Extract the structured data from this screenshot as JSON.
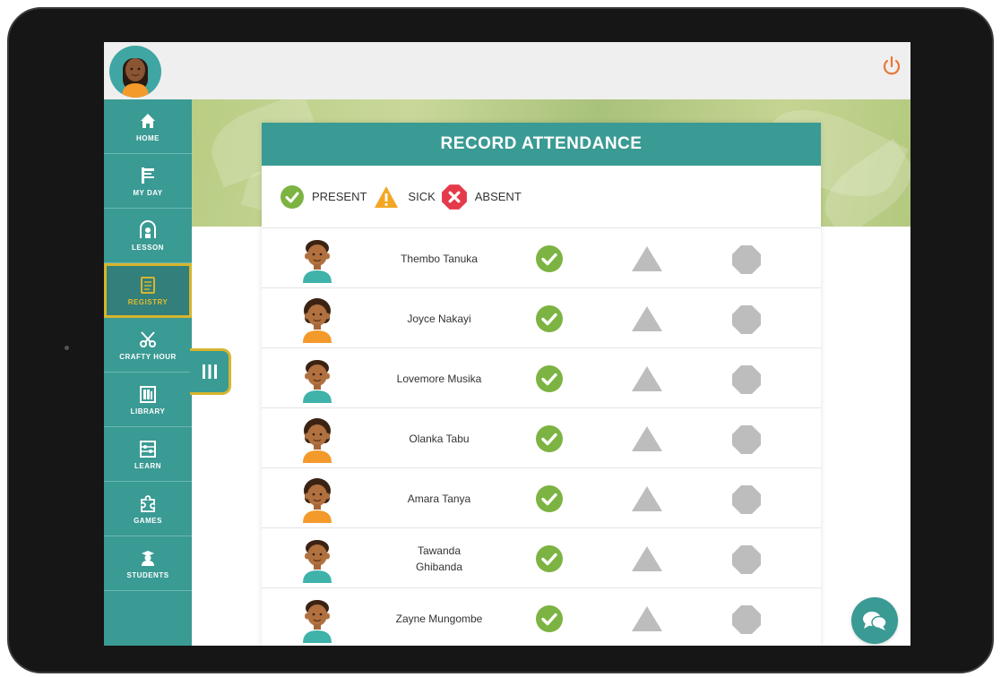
{
  "sidebar": {
    "items": [
      {
        "label": "HOME",
        "icon": "home-icon"
      },
      {
        "label": "MY DAY",
        "icon": "flag-icon"
      },
      {
        "label": "LESSON",
        "icon": "teacher-icon"
      },
      {
        "label": "REGISTRY",
        "icon": "book-icon",
        "active": true
      },
      {
        "label": "CRAFTY HOUR",
        "icon": "scissors-icon"
      },
      {
        "label": "LIBRARY",
        "icon": "library-icon"
      },
      {
        "label": "LEARN",
        "icon": "abacus-icon"
      },
      {
        "label": "GAMES",
        "icon": "puzzle-icon"
      },
      {
        "label": "STUDENTS",
        "icon": "student-icon"
      }
    ]
  },
  "panel": {
    "title": "RECORD ATTENDANCE",
    "legend": {
      "present": "PRESENT",
      "sick": "SICK",
      "absent": "ABSENT"
    }
  },
  "students": [
    {
      "name": "Thembo Tanuka",
      "gender": "boy"
    },
    {
      "name": "Joyce Nakayi",
      "gender": "girl"
    },
    {
      "name": "Lovemore Musika",
      "gender": "boy"
    },
    {
      "name": "Olanka Tabu",
      "gender": "girl"
    },
    {
      "name": "Amara Tanya",
      "gender": "girl"
    },
    {
      "name": "Tawanda Ghibanda",
      "gender": "boy"
    },
    {
      "name": "Zayne Mungombe",
      "gender": "boy"
    }
  ],
  "colors": {
    "accent": "#3a9a94",
    "active_border": "#d6b52e",
    "present": "#7cb342",
    "sick": "#f4a623",
    "absent": "#e53a4a",
    "inactive": "#bdbdbd",
    "power": "#e8763a"
  }
}
